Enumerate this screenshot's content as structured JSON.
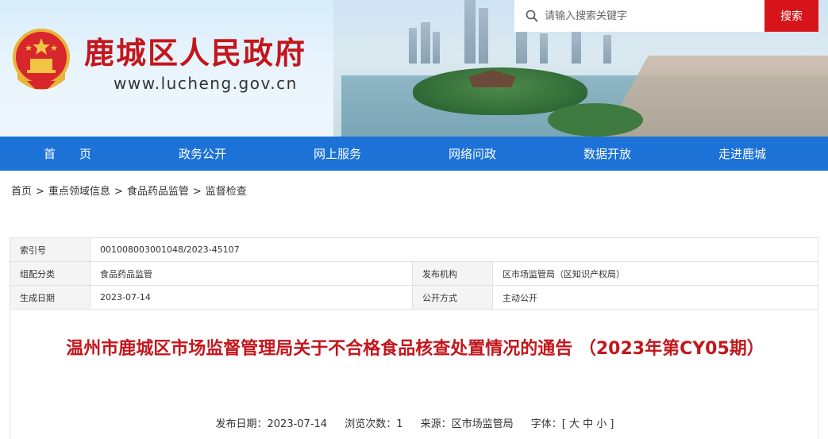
{
  "header": {
    "site_title": "鹿城区人民政府",
    "site_url": "www.lucheng.gov.cn",
    "search": {
      "placeholder": "请输入搜索关键字",
      "button_label": "搜索"
    }
  },
  "nav": {
    "items": [
      {
        "label": "首　　页"
      },
      {
        "label": "政务公开"
      },
      {
        "label": "网上服务"
      },
      {
        "label": "网络问政"
      },
      {
        "label": "数据开放"
      },
      {
        "label": "走进鹿城"
      }
    ]
  },
  "breadcrumb": {
    "items": [
      "首页",
      "重点领域信息",
      "食品药品监管",
      "监督检查"
    ],
    "separator": ">"
  },
  "meta": {
    "index_label": "索引号",
    "index_value": "001008003001048/2023-45107",
    "category_label": "组配分类",
    "category_value": "食品药品监管",
    "issuer_label": "发布机构",
    "issuer_value": "区市场监管局（区知识产权局）",
    "date_label": "生成日期",
    "date_value": "2023-07-14",
    "method_label": "公开方式",
    "method_value": "主动公开"
  },
  "article": {
    "title": "温州市鹿城区市场监督管理局关于不合格食品核查处置情况的通告 （2023年第CY05期）",
    "publish_date": "发布日期：2023-07-14",
    "views": "浏览次数：1",
    "source": "来源：区市场监管局",
    "font_size": "字体：[ 大 中 小 ]"
  },
  "colors": {
    "brand_red": "#c4161c",
    "nav_blue": "#1c72d6",
    "search_red": "#d7141a"
  }
}
